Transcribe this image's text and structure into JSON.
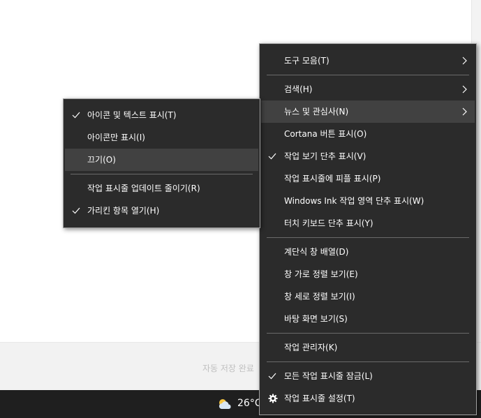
{
  "background": {
    "autosave_text": "자동 저장 완료"
  },
  "taskbar": {
    "weather_icon": "partly-cloudy-icon",
    "temperature": "26°C"
  },
  "main_menu": {
    "items": [
      {
        "label": "도구 모음(T)",
        "has_submenu": true
      },
      {
        "label": "검색(H)",
        "has_submenu": true
      },
      {
        "label": "뉴스 및 관심사(N)",
        "has_submenu": true,
        "highlighted": true
      },
      {
        "label": "Cortana 버튼 표시(O)"
      },
      {
        "label": "작업 보기 단추 표시(V)",
        "checked": true
      },
      {
        "label": "작업 표시줄에 피플 표시(P)"
      },
      {
        "label": "Windows Ink 작업 영역 단추 표시(W)"
      },
      {
        "label": "터치 키보드 단추 표시(Y)"
      },
      {
        "label": "계단식 창 배열(D)"
      },
      {
        "label": "창 가로 정렬 보기(E)"
      },
      {
        "label": "창 세로 정렬 보기(I)"
      },
      {
        "label": "바탕 화면 보기(S)"
      },
      {
        "label": "작업 관리자(K)"
      },
      {
        "label": "모든 작업 표시줄 잠금(L)",
        "checked": true
      },
      {
        "label": "작업 표시줄 설정(T)",
        "icon": "gear-icon"
      }
    ]
  },
  "sub_menu": {
    "items": [
      {
        "label": "아이콘 및 텍스트 표시(T)",
        "checked": true
      },
      {
        "label": "아이콘만 표시(I)"
      },
      {
        "label": "끄기(O)",
        "highlighted": true
      },
      {
        "label": "작업 표시줄 업데이트 줄이기(R)"
      },
      {
        "label": "가리킨 항목 열기(H)",
        "checked": true
      }
    ]
  },
  "colors": {
    "menu_bg": "#2b2b2b",
    "menu_hover": "#414141",
    "menu_text": "#ffffff",
    "separator": "#6b6b6b",
    "taskbar": "#1f1f1f"
  }
}
